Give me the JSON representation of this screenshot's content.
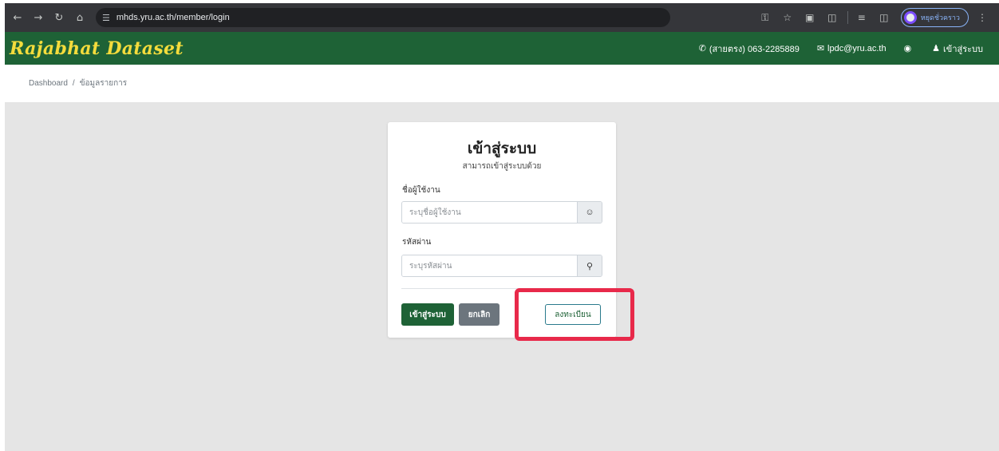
{
  "browser": {
    "url": "mhds.yru.ac.th/member/login",
    "profile_label": "หยุดชั่วคราว"
  },
  "navbar": {
    "brand": "Rajabhat Dataset",
    "phone": "(สายตรง) 063-2285889",
    "email": "lpdc@yru.ac.th",
    "login_link": "เข้าสู่ระบบ",
    "accent_color": "#1e6236",
    "brand_color": "#f4dc3c"
  },
  "breadcrumb": {
    "items": [
      "Dashboard",
      "ข้อมูลรายการ"
    ],
    "separator": "/"
  },
  "login_card": {
    "title": "เข้าสู่ระบบ",
    "subtitle": "สามารถเข้าสู่ระบบด้วย",
    "username_label": "ชื่อผู้ใช้งาน",
    "username_placeholder": "ระบุชื่อผู้ใช้งาน",
    "password_label": "รหัสผ่าน",
    "password_placeholder": "ระบุรหัสผ่าน",
    "login_button": "เข้าสู่ระบบ",
    "cancel_button": "ยกเลิก",
    "register_button": "ลงทะเบียน"
  },
  "icons": {
    "back": "arrow-left-icon",
    "forward": "arrow-right-icon",
    "reload": "reload-icon",
    "home": "home-icon",
    "site_info": "tune-icon",
    "password_key": "key-icon",
    "bookmark": "star-icon",
    "phone": "phone-icon",
    "email": "envelope-icon",
    "globe": "globe-icon",
    "user": "users-icon",
    "user_circle": "user-circle-icon",
    "input_key": "key-icon"
  },
  "highlight_color": "#e8294a"
}
